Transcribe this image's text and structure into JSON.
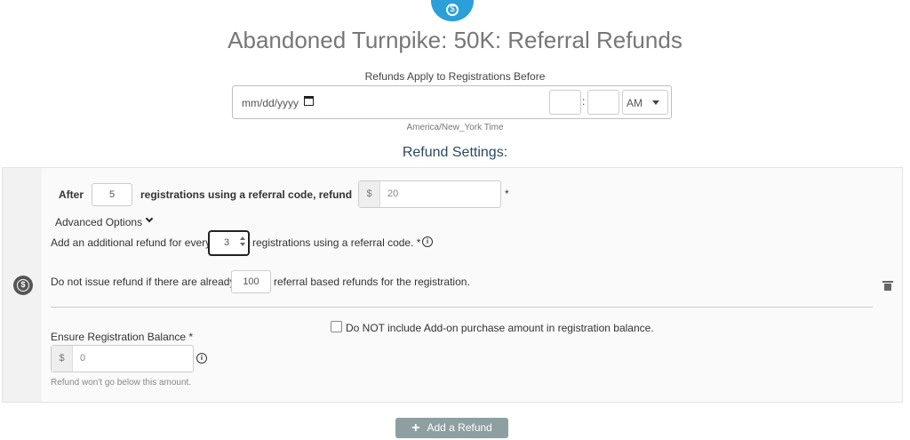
{
  "header": {
    "logo_icon": "dollar-circle-icon",
    "logo_glyph": "$",
    "title": "Abandoned Turnpike: 50K: Referral Refunds"
  },
  "date_filter": {
    "label": "Refunds Apply to Registrations Before",
    "date_placeholder": "mm/dd/yyyy",
    "hour_value": "",
    "minute_value": "",
    "time_separator": ":",
    "ampm_value": "AM",
    "timezone": "America/New_York Time"
  },
  "refund_settings": {
    "heading": "Refund Settings:",
    "row_icon": "dollar-circle-icon",
    "row_icon_glyph": "$",
    "after_label": "After",
    "after_count": "5",
    "using_code_label": "registrations using a referral code, refund",
    "currency": "$",
    "refund_amount": "20",
    "required_mark": "*",
    "advanced_options_label": "Advanced Options",
    "additional_prefix": "Add an additional refund for every",
    "additional_count": "3",
    "additional_suffix": "registrations using a referral code. *",
    "info_glyph": "i",
    "max_prefix": "Do not issue refund if there are already",
    "max_count": "100",
    "max_suffix": "referral based refunds for the registration.",
    "addon_checkbox_label": "Do NOT include Add-on purchase amount in registration balance.",
    "addon_checked": false,
    "balance_label": "Ensure Registration Balance *",
    "balance_value": "0",
    "balance_hint": "Refund won't go below this amount."
  },
  "actions": {
    "add_refund_label": "Add a Refund",
    "add_refund_glyph": "+"
  },
  "colors": {
    "accent": "#2a9fd8",
    "heading": "#2c4a60",
    "button": "#8e9fa1"
  }
}
